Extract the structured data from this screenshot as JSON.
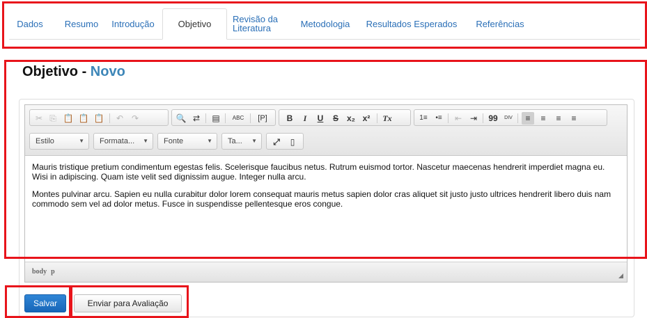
{
  "tabs": [
    {
      "label": "Dados"
    },
    {
      "label": "Resumo"
    },
    {
      "label": "Introdução"
    },
    {
      "label": "Objetivo",
      "active": true
    },
    {
      "label_line1": "Revisão da",
      "label_line2": "Literatura"
    },
    {
      "label": "Metodologia"
    },
    {
      "label": "Resultados Esperados"
    },
    {
      "label": "Referências"
    }
  ],
  "heading": {
    "title": "Objetivo - ",
    "subtitle": "Novo"
  },
  "editor": {
    "toolbar_row1": {
      "clipboard": [
        "✂",
        "⎘",
        "📋",
        "📋",
        "📋"
      ],
      "history": [
        "↶",
        "↷"
      ],
      "find": [
        "🔍",
        "⇄"
      ],
      "select_all": "▤",
      "spellcheck": "ABC",
      "show_blocks": "[P]",
      "format": {
        "bold": "B",
        "italic": "I",
        "underline": "U",
        "strike": "S",
        "subscript": "x₂",
        "superscript": "x²",
        "remove_format": "Tx"
      },
      "lists": [
        "1≡",
        "•≡"
      ],
      "indent": [
        "⇤",
        "⇥"
      ],
      "blockquote": "99",
      "div": "DIV",
      "align": [
        "≡",
        "≡",
        "≡",
        "≡"
      ]
    },
    "toolbar_row2": {
      "style_combo": "Estilo",
      "format_combo": "Formata...",
      "font_combo": "Fonte",
      "size_combo": "Ta...",
      "maximize": "⤢",
      "show_source": "▯"
    },
    "paragraphs": [
      "Mauris tristique pretium condimentum egestas felis. Scelerisque faucibus netus. Rutrum euismod tortor. Nascetur maecenas hendrerit imperdiet magna eu. Wisi in adipiscing. Quam iste velit sed dignissim augue. Integer nulla arcu.",
      "Montes pulvinar arcu. Sapien eu nulla curabitur dolor lorem consequat mauris metus sapien dolor cras aliquet sit justo justo ultrices hendrerit libero duis nam commodo sem vel ad dolor metus. Fusce in suspendisse pellentesque eros congue."
    ],
    "path": [
      "body",
      "p"
    ]
  },
  "buttons": {
    "save": "Salvar",
    "send": "Enviar para Avaliação"
  },
  "colors": {
    "annotation_red": "#e8141b",
    "link_blue": "#2a6fb7",
    "heading_blue": "#3d86b8",
    "save_blue": "#1f73c6"
  }
}
